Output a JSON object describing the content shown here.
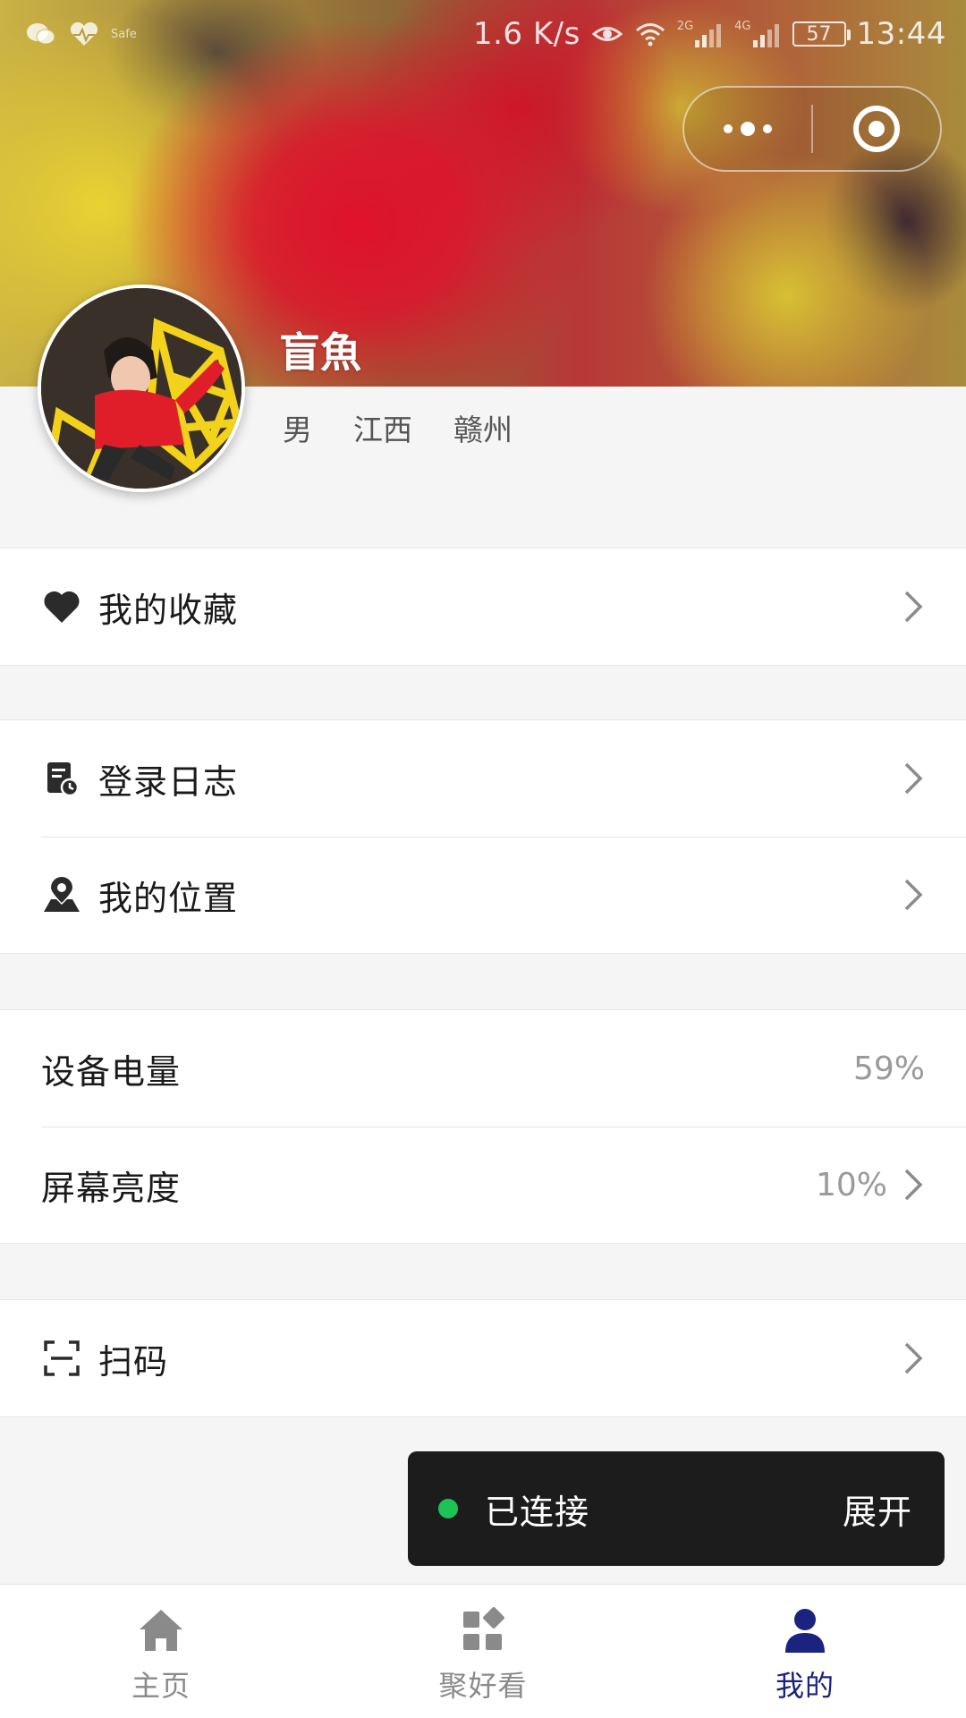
{
  "status_bar": {
    "speed": "1.6 K/s",
    "signal_2g": "2G",
    "signal_4g": "4G",
    "battery": "57",
    "time": "13:44",
    "safe_label": "Safe"
  },
  "capsule": {
    "more_icon": "more-dots-icon",
    "close_icon": "target-close-icon"
  },
  "profile": {
    "name": "盲魚",
    "gender": "男",
    "province": "江西",
    "city": "赣州"
  },
  "menu": {
    "favorites": {
      "label": "我的收藏",
      "icon": "heart-icon"
    },
    "login_log": {
      "label": "登录日志",
      "icon": "log-icon"
    },
    "location": {
      "label": "我的位置",
      "icon": "location-pin-icon"
    },
    "battery": {
      "label": "设备电量",
      "value": "59%"
    },
    "brightness": {
      "label": "屏幕亮度",
      "value": "10%"
    },
    "scan": {
      "label": "扫码",
      "icon": "scan-icon"
    }
  },
  "toast": {
    "status": "已连接",
    "action": "展开",
    "status_color": "#1bc455"
  },
  "tabs": [
    {
      "label": "主页",
      "icon": "home-icon"
    },
    {
      "label": "聚好看",
      "icon": "apps-icon"
    },
    {
      "label": "我的",
      "icon": "user-icon",
      "active": true
    }
  ],
  "colors": {
    "active_tab": "#1a237e",
    "inactive_tab": "#8a8a8a",
    "toast_bg": "#1c1c1c"
  }
}
